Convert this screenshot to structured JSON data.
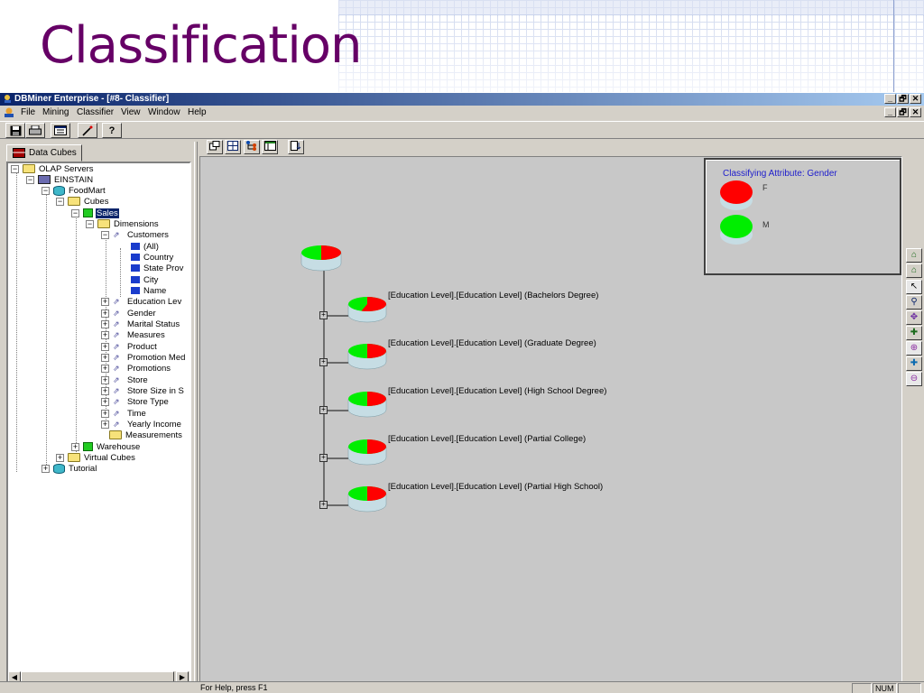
{
  "slide": {
    "title": "Classification"
  },
  "window": {
    "title": "DBMiner Enterprise - [#8- Classifier]",
    "buttons": {
      "minimize": "_",
      "restore": "🗗",
      "close": "✕"
    }
  },
  "menu": [
    "File",
    "Mining",
    "Classifier",
    "View",
    "Window",
    "Help"
  ],
  "toolbar": {
    "help_label": "?"
  },
  "left_panel": {
    "tab": "Data Cubes",
    "tree": [
      "OLAP Servers",
      "EINSTAIN",
      "FoodMart",
      "Cubes",
      "Sales",
      "Dimensions",
      "Customers",
      "(All)",
      "Country",
      "State Prov",
      "City",
      "Name",
      "Education Lev",
      "Gender",
      "Marital Status",
      "Measures",
      "Product",
      "Promotion Med",
      "Promotions",
      "Store",
      "Store Size in S",
      "Store Type",
      "Time",
      "Yearly Income",
      "Measurements",
      "Warehouse",
      "Virtual Cubes",
      "Tutorial"
    ]
  },
  "legend": {
    "title": "Classifying Attribute: Gender",
    "items": [
      {
        "label": "F",
        "color": "#ff0000"
      },
      {
        "label": "M",
        "color": "#00ee00"
      }
    ]
  },
  "tree_nodes": [
    {
      "label": "[Education Level].[Education Level] (Bachelors Degree)",
      "female_share": 0.55
    },
    {
      "label": "[Education Level].[Education Level] (Graduate Degree)",
      "female_share": 0.5
    },
    {
      "label": "[Education Level].[Education Level] (High School Degree)",
      "female_share": 0.5
    },
    {
      "label": "[Education Level].[Education Level] (Partial College)",
      "female_share": 0.5
    },
    {
      "label": "[Education Level].[Education Level] (Partial High School)",
      "female_share": 0.5
    }
  ],
  "root_female_share": 0.5,
  "colors": {
    "female": "#ff0000",
    "male": "#00ee00",
    "disk_side": "#c6dde4"
  },
  "status": {
    "help_text": "For Help, press F1",
    "num": "NUM"
  }
}
